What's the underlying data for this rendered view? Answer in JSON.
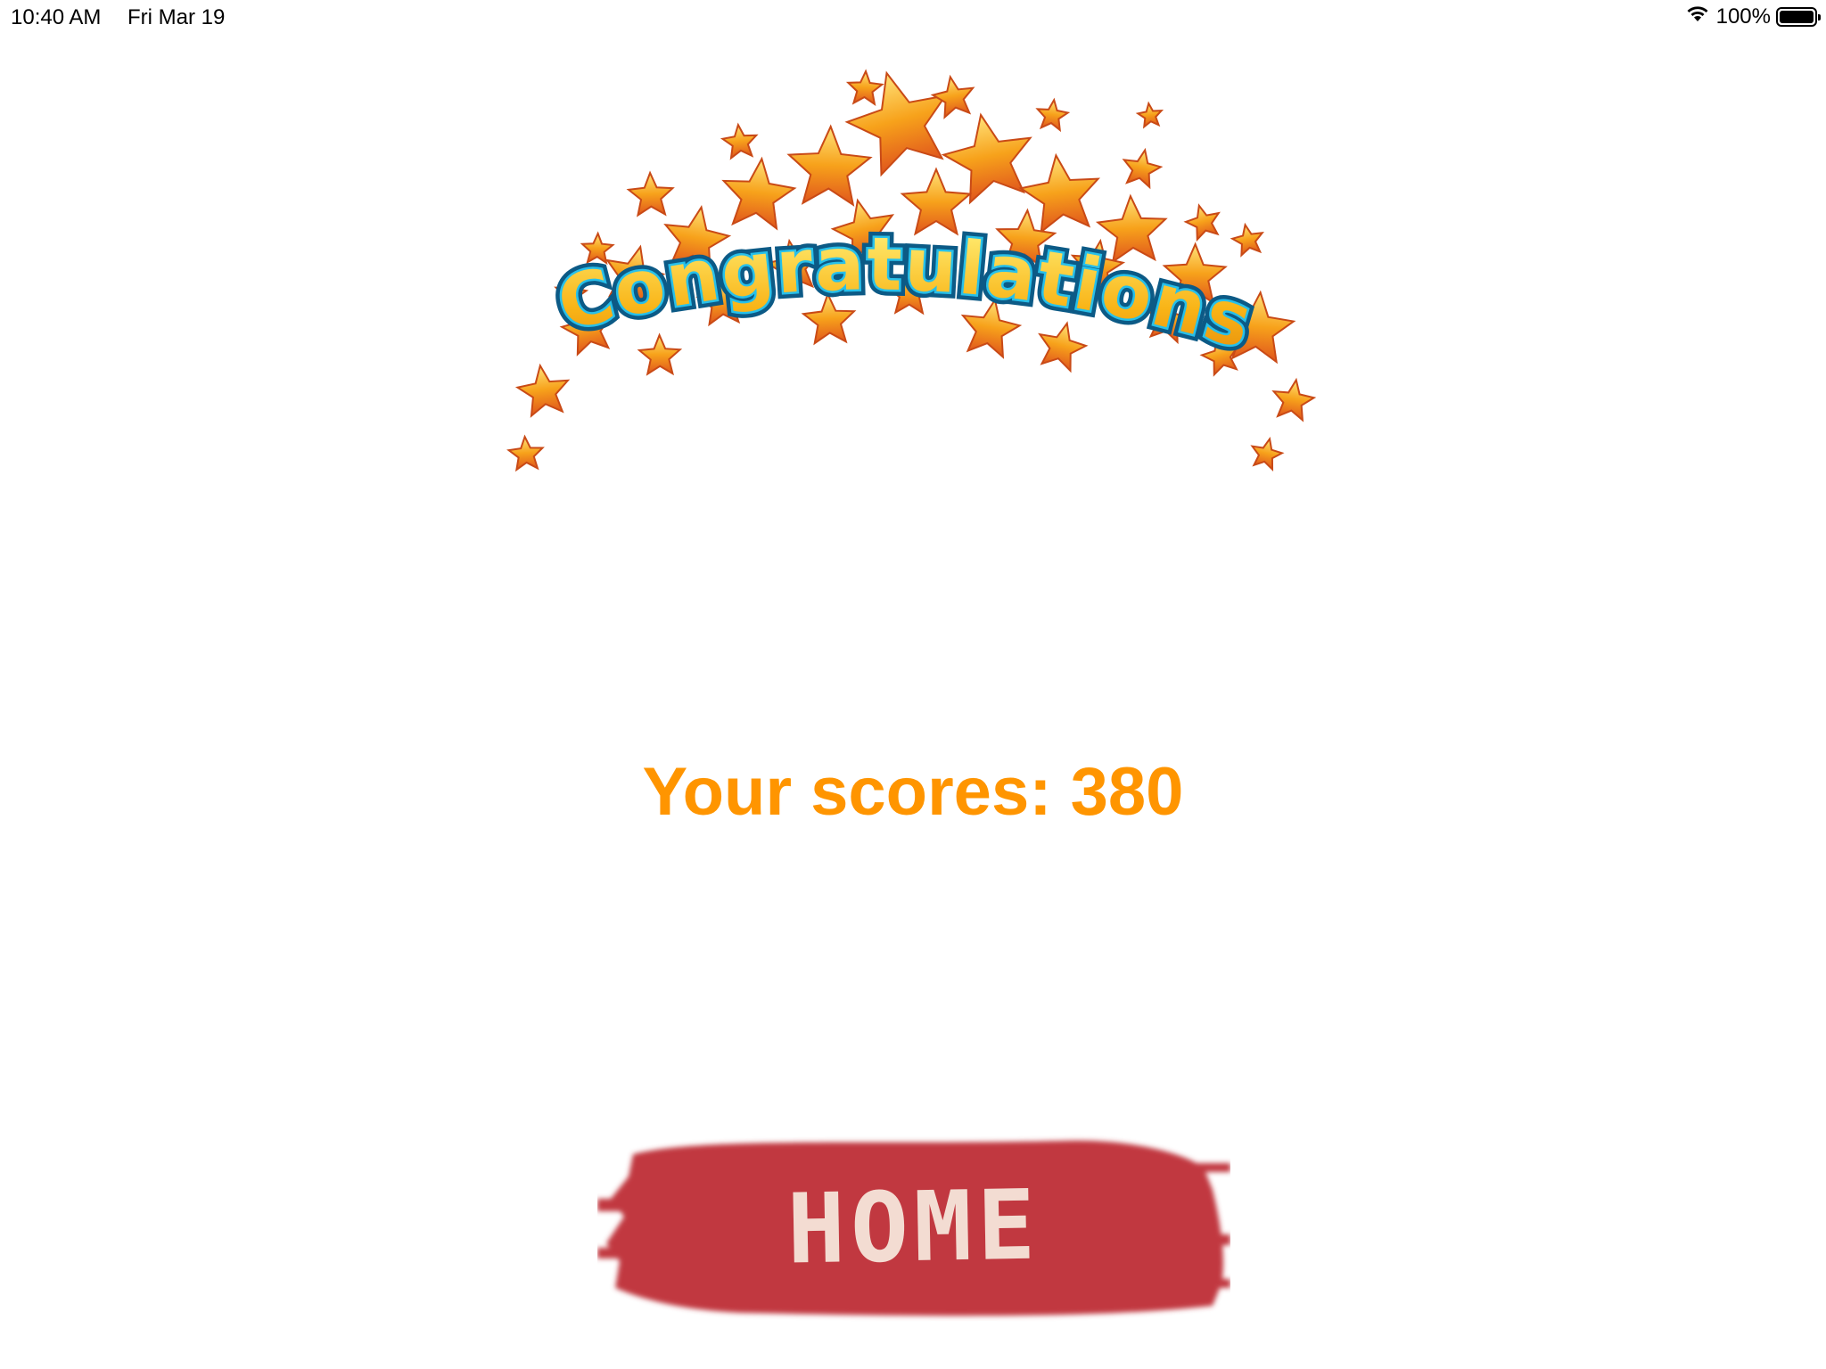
{
  "status_bar": {
    "time": "10:40 AM",
    "date": "Fri Mar 19",
    "battery_percent": "100%",
    "battery_level": 1.0,
    "icons": [
      "wifi-icon",
      "battery-icon"
    ]
  },
  "banner": {
    "text": "Congratulations",
    "graphic": "star-burst-arc"
  },
  "score": {
    "label": "Your scores: 380"
  },
  "home_button": {
    "label": "HOME"
  },
  "colors": {
    "score_text": "#ff9500",
    "home_brush": "#c1393f",
    "home_text": "#f3dcd2",
    "star_fill": "#f7a21b",
    "banner_outline": "#1fa6d6"
  }
}
